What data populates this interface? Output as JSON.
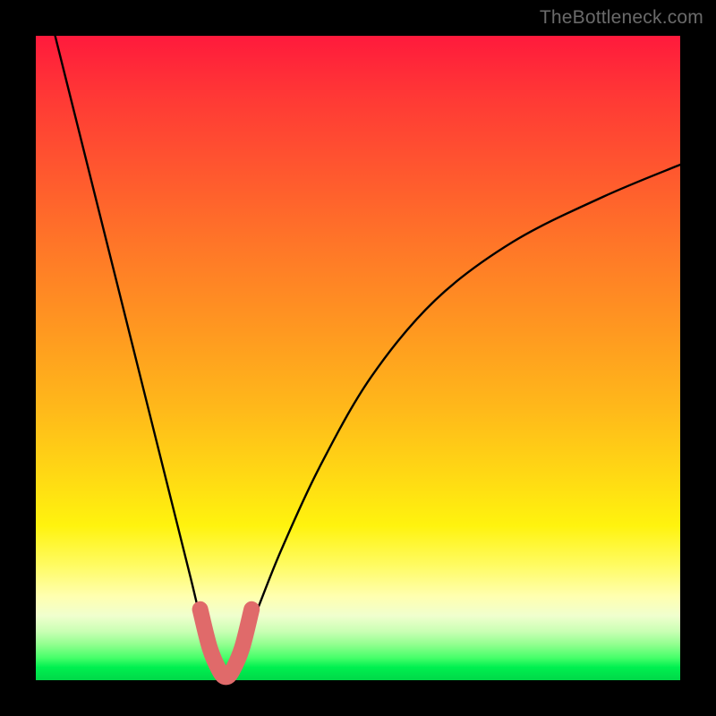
{
  "watermark": "TheBottleneck.com",
  "chart_data": {
    "type": "line",
    "title": "",
    "xlabel": "",
    "ylabel": "",
    "xlim": [
      0,
      100
    ],
    "ylim": [
      0,
      100
    ],
    "grid": false,
    "series": [
      {
        "name": "bottleneck-curve",
        "color": "#000000",
        "x": [
          3,
          6,
          9,
          12,
          15,
          18,
          21,
          24,
          26,
          28,
          29.5,
          31,
          34,
          38,
          44,
          52,
          62,
          74,
          88,
          100
        ],
        "y": [
          100,
          88,
          76,
          64,
          52,
          40,
          28,
          16,
          8,
          3,
          0.5,
          3,
          10,
          20,
          33,
          47,
          59,
          68,
          75,
          80
        ]
      },
      {
        "name": "highlight-band",
        "color": "#e06a6a",
        "x": [
          25.5,
          27,
          28.5,
          29.5,
          30.5,
          32,
          33.5
        ],
        "y": [
          11,
          5,
          1.5,
          0.5,
          1.5,
          5,
          11
        ]
      }
    ],
    "background_gradient": {
      "top": "#ff1a3c",
      "mid": "#ffd814",
      "bottom": "#00d848"
    },
    "note": "Axes have no visible tick labels; x/y values are estimated as percentages of plot width/height. Curve minimum is at approximately x≈29.5."
  }
}
